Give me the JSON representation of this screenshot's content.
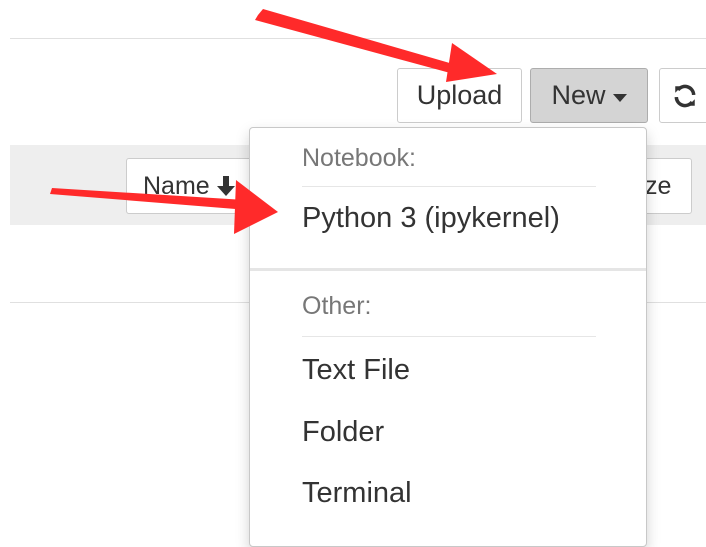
{
  "toolbar": {
    "upload_label": "Upload",
    "new_label": "New",
    "refresh_icon": "refresh-icon"
  },
  "list_header": {
    "name_label": "Name",
    "size_label_partial": "ze",
    "sort_icon": "arrow-down-icon"
  },
  "new_menu": {
    "notebook_header": "Notebook:",
    "kernel_item": "Python 3 (ipykernel)",
    "other_header": "Other:",
    "items": [
      "Text File",
      "Folder",
      "Terminal"
    ]
  },
  "annotations": {
    "arrow_color": "#ff2a2a"
  }
}
